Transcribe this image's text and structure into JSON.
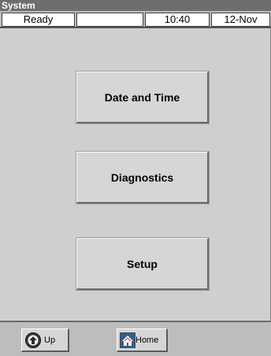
{
  "window": {
    "title": "System"
  },
  "status": {
    "state": "Ready",
    "field2": "",
    "time": "10:40",
    "date": "12-Nov"
  },
  "menu": [
    {
      "label": "Date and Time"
    },
    {
      "label": "Diagnostics"
    },
    {
      "label": "Setup"
    }
  ],
  "nav": {
    "up_label": "Up",
    "home_label": "Home",
    "up_icon": "up-arrow-icon",
    "home_icon": "home-icon"
  }
}
